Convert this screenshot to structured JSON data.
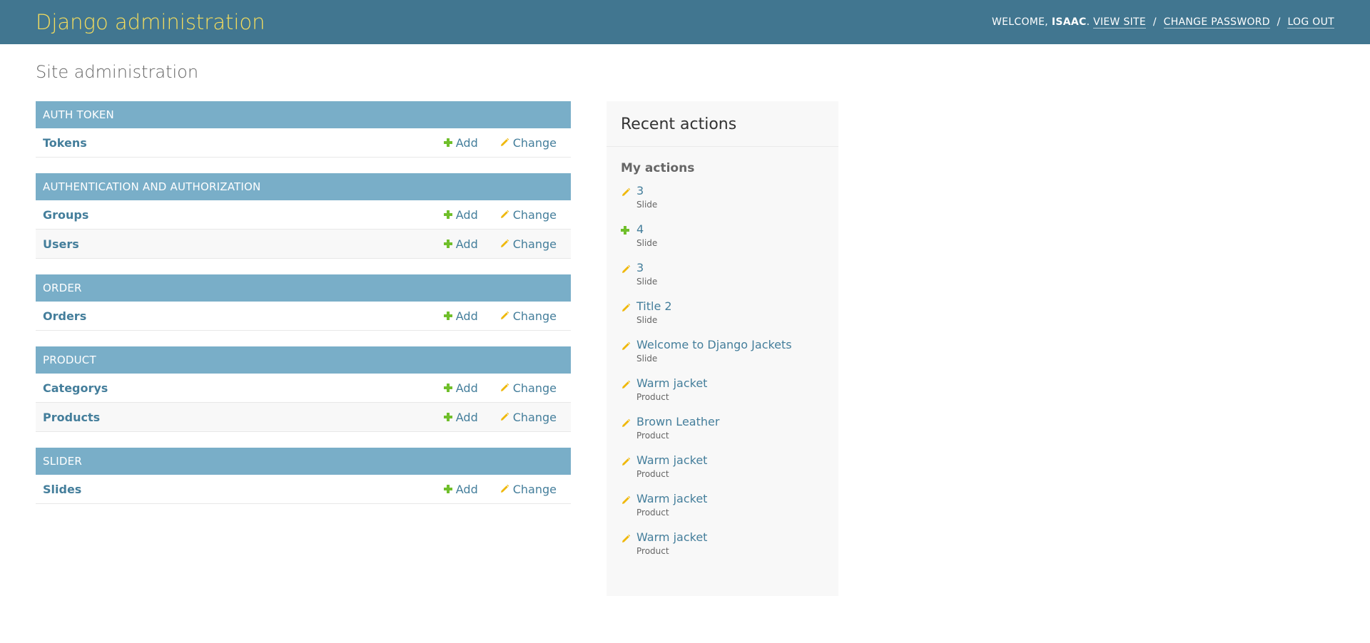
{
  "header": {
    "site_name": "Django administration",
    "welcome": "Welcome,",
    "username": "Isaac",
    "view_site": "View site",
    "change_password": "Change password",
    "log_out": "Log out",
    "colors": {
      "bg": "#417690",
      "brand": "#f5dd5d"
    }
  },
  "page_title": "Site administration",
  "modules": [
    {
      "caption": "Auth Token",
      "models": [
        {
          "name": "Tokens",
          "add": "Add",
          "change": "Change"
        }
      ]
    },
    {
      "caption": "Authentication and Authorization",
      "models": [
        {
          "name": "Groups",
          "add": "Add",
          "change": "Change"
        },
        {
          "name": "Users",
          "add": "Add",
          "change": "Change"
        }
      ]
    },
    {
      "caption": "Order",
      "models": [
        {
          "name": "Orders",
          "add": "Add",
          "change": "Change"
        }
      ]
    },
    {
      "caption": "Product",
      "models": [
        {
          "name": "Categorys",
          "add": "Add",
          "change": "Change"
        },
        {
          "name": "Products",
          "add": "Add",
          "change": "Change"
        }
      ]
    },
    {
      "caption": "Slider",
      "models": [
        {
          "name": "Slides",
          "add": "Add",
          "change": "Change"
        }
      ]
    }
  ],
  "recent": {
    "title": "Recent actions",
    "my_actions": "My actions",
    "items": [
      {
        "icon": "pencil-icon",
        "label": "3",
        "type": "Slide"
      },
      {
        "icon": "plus-icon",
        "label": "4",
        "type": "Slide"
      },
      {
        "icon": "pencil-icon",
        "label": "3",
        "type": "Slide"
      },
      {
        "icon": "pencil-icon",
        "label": "Title 2",
        "type": "Slide"
      },
      {
        "icon": "pencil-icon",
        "label": "Welcome to Django Jackets",
        "type": "Slide"
      },
      {
        "icon": "pencil-icon",
        "label": "Warm jacket",
        "type": "Product"
      },
      {
        "icon": "pencil-icon",
        "label": "Brown Leather",
        "type": "Product"
      },
      {
        "icon": "pencil-icon",
        "label": "Warm jacket",
        "type": "Product"
      },
      {
        "icon": "pencil-icon",
        "label": "Warm jacket",
        "type": "Product"
      },
      {
        "icon": "pencil-icon",
        "label": "Warm jacket",
        "type": "Product"
      }
    ]
  },
  "colors": {
    "caption_bg": "#79aec8",
    "link": "#447e9b",
    "add_green": "#70bf2b",
    "change_yellow": "#efb80b"
  }
}
